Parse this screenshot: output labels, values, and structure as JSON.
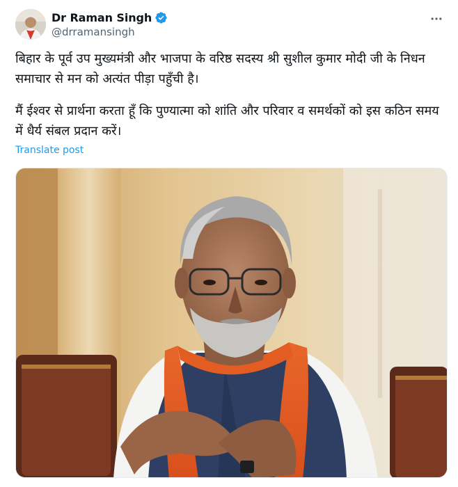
{
  "author": {
    "display_name": "Dr Raman Singh",
    "handle": "@drramansingh",
    "verified": true,
    "avatar_icon": "profile-photo"
  },
  "menu": {
    "icon": "more-horizontal-icon"
  },
  "post": {
    "paragraphs": [
      "बिहार के पूर्व उप मुख्यमंत्री और भाजपा के वरिष्ठ सदस्य श्री सुशील कुमार मोदी जी के निधन समाचार से मन को अत्यंत पीड़ा पहुँची है।",
      "मैं ईश्वर से प्रार्थना करता हूँ कि पुण्यात्मा को शांति और परिवार व समर्थकों को इस कठिन समय में धैर्य संबल प्रदान करें।"
    ],
    "translate_label": "Translate post"
  },
  "colors": {
    "link": "#1d9bf0",
    "verified": "#1d9bf0",
    "text": "#0f1419",
    "secondary_text": "#536471"
  }
}
